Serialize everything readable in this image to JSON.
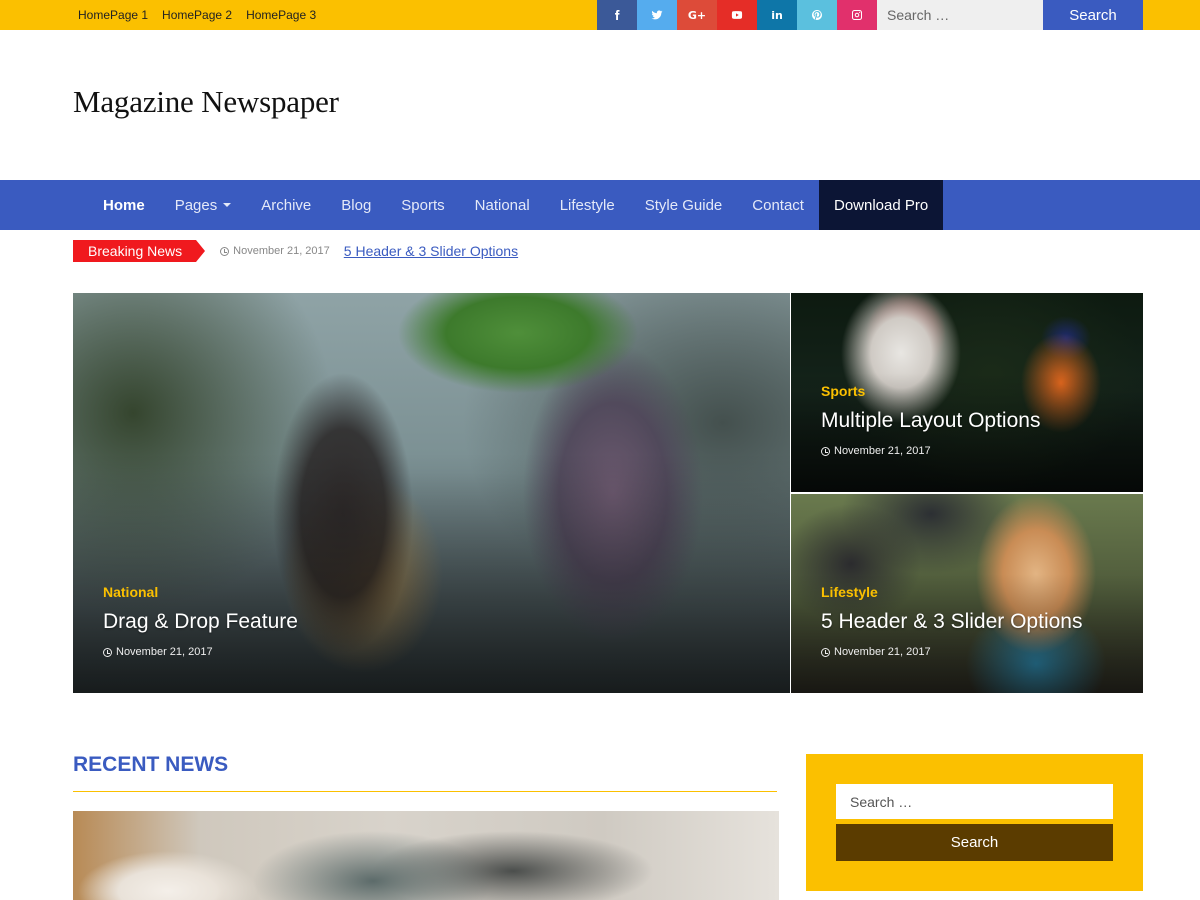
{
  "topbar": {
    "links": [
      "HomePage 1",
      "HomePage 2",
      "HomePage 3"
    ],
    "socials": [
      {
        "icon": "facebook-icon",
        "color": "#3b5998"
      },
      {
        "icon": "twitter-icon",
        "color": "#55acee"
      },
      {
        "icon": "google-plus-icon",
        "color": "#dd4b39"
      },
      {
        "icon": "youtube-icon",
        "color": "#e52d27"
      },
      {
        "icon": "linkedin-icon",
        "color": "#0e76a8"
      },
      {
        "icon": "pinterest-icon",
        "color": "#5bc0de"
      },
      {
        "icon": "instagram-icon",
        "color": "#e1306c"
      }
    ],
    "search_placeholder": "Search …",
    "search_button": "Search"
  },
  "header": {
    "site_title": "Magazine Newspaper"
  },
  "nav": {
    "items": [
      "Home",
      "Pages",
      "Archive",
      "Blog",
      "Sports",
      "National",
      "Lifestyle",
      "Style Guide",
      "Contact",
      "Download Pro"
    ]
  },
  "breaking": {
    "label": "Breaking News",
    "date": "November 21, 2017",
    "title": "5 Header & 3 Slider Options"
  },
  "featured": [
    {
      "category": "National",
      "title": "Drag & Drop Feature",
      "date": "November 21, 2017"
    },
    {
      "category": "Sports",
      "title": "Multiple Layout Options",
      "date": "November 21, 2017"
    },
    {
      "category": "Lifestyle",
      "title": "5 Header & 3 Slider Options",
      "date": "November 21, 2017"
    }
  ],
  "recent": {
    "title": "RECENT NEWS"
  },
  "sidebar": {
    "search_placeholder": "Search …",
    "search_button": "Search"
  },
  "colors": {
    "accent_yellow": "#fbc000",
    "nav_blue": "#3a5bc0",
    "pro_dark": "#0c1535",
    "breaking_red": "#f0191e",
    "widget_button": "#5b3c00"
  }
}
